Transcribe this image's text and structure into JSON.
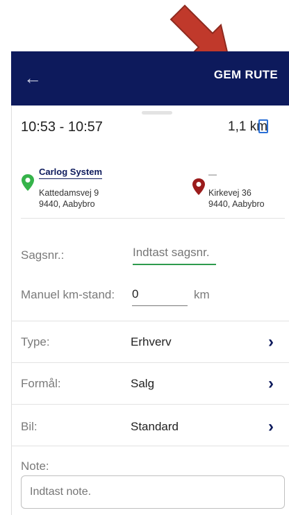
{
  "appbar": {
    "back_icon": "arrow-left-icon",
    "save_label": "GEM RUTE",
    "bg_color": "#0d1a5c"
  },
  "trip": {
    "time_range": "10:53 - 10:57",
    "distance": "1,1 km",
    "device_icon": "phone-icon"
  },
  "route": {
    "from": {
      "name": "Carlog System",
      "street": "Kattedamsvej 9",
      "city": "9440, Aabybro",
      "pin_color": "#35b34a"
    },
    "to": {
      "name": "—",
      "street": "Kirkevej 36",
      "city": "9440, Aabybro",
      "pin_color": "#9b1c1c"
    }
  },
  "form": {
    "case_label": "Sagsnr.:",
    "case_placeholder": "Indtast sagsnr.",
    "km_label": "Manuel km-stand:",
    "km_value": "0",
    "km_unit": "km",
    "type_label": "Type:",
    "type_value": "Erhverv",
    "purpose_label": "Formål:",
    "purpose_value": "Salg",
    "car_label": "Bil:",
    "car_value": "Standard",
    "note_label": "Note:",
    "note_placeholder": "Indtast note."
  }
}
